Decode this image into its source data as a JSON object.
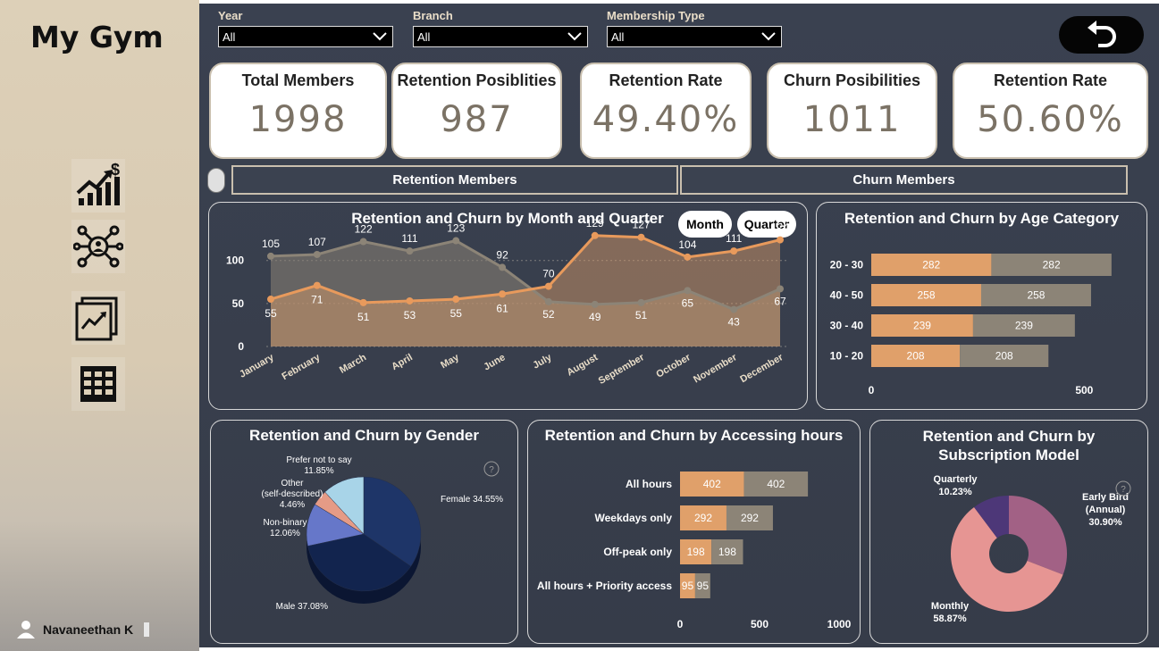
{
  "app": {
    "title": "My Gym"
  },
  "nav": [
    {
      "icon": "finance-chart-icon"
    },
    {
      "icon": "network-user-icon"
    },
    {
      "icon": "trend-report-icon"
    },
    {
      "icon": "table-grid-icon"
    }
  ],
  "user": {
    "name": "Navaneethan K",
    "icon": "user-icon"
  },
  "filters": [
    {
      "label": "Year",
      "value": "All"
    },
    {
      "label": "Branch",
      "value": "All"
    },
    {
      "label": "Membership Type",
      "value": "All"
    }
  ],
  "back_icon": "undo-arrow-icon",
  "kpis": [
    {
      "label": "Total Members",
      "value": "1998"
    },
    {
      "label": "Retention Posiblities",
      "value": "987"
    },
    {
      "label": "Retention Rate",
      "value": "49.40%"
    },
    {
      "label": "Churn Posibilities",
      "value": "1011"
    },
    {
      "label": "Retention Rate",
      "value": "50.60%"
    }
  ],
  "tabs": {
    "retention": "Retention Members",
    "churn": "Churn Members"
  },
  "toggle": {
    "month": "Month",
    "quarter": "Quarter"
  },
  "colors": {
    "retention": "#e0a06a",
    "churn": "#8c8477",
    "panel_bg": "#3a4150",
    "sidebar": "#ddd0b8"
  },
  "chart_data": [
    {
      "type": "area",
      "title": "Retention and Churn by Month and Quarter",
      "categories": [
        "January",
        "February",
        "March",
        "April",
        "May",
        "June",
        "July",
        "August",
        "September",
        "October",
        "November",
        "December"
      ],
      "series": [
        {
          "values": [
            105,
            107,
            122,
            111,
            123,
            92,
            52,
            49,
            51,
            65,
            43,
            67
          ]
        },
        {
          "values": [
            55,
            71,
            51,
            53,
            55,
            61,
            70,
            129,
            127,
            104,
            111,
            124
          ]
        }
      ],
      "yticks": [
        "0",
        "50",
        "100"
      ],
      "ylim": [
        0,
        135
      ]
    },
    {
      "type": "bar",
      "title": "Retention and Churn by Age Category",
      "categories": [
        "20 - 30",
        "40 - 50",
        "30 - 40",
        "10 - 20"
      ],
      "series": [
        {
          "values": [
            282,
            258,
            239,
            208
          ]
        },
        {
          "values": [
            282,
            258,
            239,
            208
          ]
        }
      ],
      "xticks": [
        "0",
        "500"
      ],
      "xlim": [
        0,
        600
      ]
    },
    {
      "type": "pie",
      "title": "Retention and Churn by Gender",
      "slices": [
        {
          "label": "Female",
          "pct": "34.55%",
          "value": 34.55,
          "color": "#1e3568"
        },
        {
          "label": "Male",
          "pct": "37.08%",
          "value": 37.08,
          "color": "#12244e"
        },
        {
          "label": "Non-binary",
          "pct": "12.06%",
          "value": 12.06,
          "color": "#6677c9"
        },
        {
          "label": "Other (self-described)",
          "pct": "4.46%",
          "value": 4.46,
          "color": "#e59b86"
        },
        {
          "label": "Prefer not to say",
          "pct": "11.85%",
          "value": 11.85,
          "color": "#a8d4e8"
        }
      ]
    },
    {
      "type": "bar",
      "title": "Retention and Churn by Accessing hours",
      "categories": [
        "All hours",
        "Weekdays only",
        "Off-peak only",
        "All hours + Priority access"
      ],
      "series": [
        {
          "values": [
            402,
            292,
            198,
            95
          ]
        },
        {
          "values": [
            402,
            292,
            198,
            95
          ]
        }
      ],
      "xticks": [
        "0",
        "500",
        "1000"
      ],
      "xlim": [
        0,
        1000
      ]
    },
    {
      "type": "pie",
      "title": "Retention and Churn by Subscription Model",
      "slices": [
        {
          "label": "Early Bird (Annual)",
          "pct": "30.90%",
          "value": 30.9,
          "color": "#a26185"
        },
        {
          "label": "Monthly",
          "pct": "58.87%",
          "value": 58.87,
          "color": "#e69593"
        },
        {
          "label": "Quarterly",
          "pct": "10.23%",
          "value": 10.23,
          "color": "#4d3778"
        }
      ]
    }
  ]
}
